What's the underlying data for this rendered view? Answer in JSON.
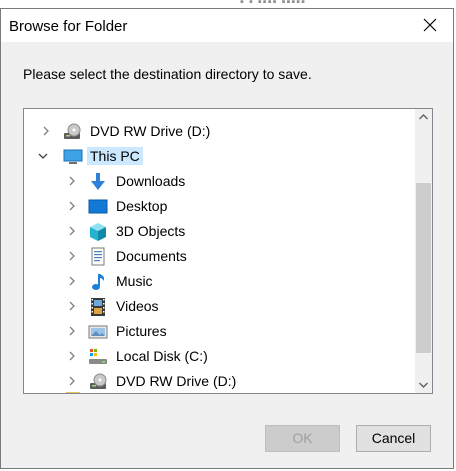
{
  "dialog": {
    "title": "Browse for Folder",
    "instruction": "Please select the destination directory to save."
  },
  "tree": {
    "items": [
      {
        "label": "DVD RW Drive (D:)",
        "icon": "dvd-drive-icon",
        "expanded": false,
        "selected": false
      },
      {
        "label": "This PC",
        "icon": "computer-icon",
        "expanded": true,
        "selected": true
      },
      {
        "label": "Downloads",
        "icon": "downloads-icon",
        "expanded": false,
        "selected": false
      },
      {
        "label": "Desktop",
        "icon": "desktop-icon",
        "expanded": false,
        "selected": false
      },
      {
        "label": "3D Objects",
        "icon": "3d-objects-icon",
        "expanded": false,
        "selected": false
      },
      {
        "label": "Documents",
        "icon": "documents-icon",
        "expanded": false,
        "selected": false
      },
      {
        "label": "Music",
        "icon": "music-icon",
        "expanded": false,
        "selected": false
      },
      {
        "label": "Videos",
        "icon": "videos-icon",
        "expanded": false,
        "selected": false
      },
      {
        "label": "Pictures",
        "icon": "pictures-icon",
        "expanded": false,
        "selected": false
      },
      {
        "label": "Local Disk (C:)",
        "icon": "local-disk-icon",
        "expanded": false,
        "selected": false
      },
      {
        "label": "DVD RW Drive (D:)",
        "icon": "dvd-drive-icon",
        "expanded": false,
        "selected": false
      }
    ]
  },
  "buttons": {
    "ok": "OK",
    "cancel": "Cancel"
  },
  "colors": {
    "selection": "#cce8ff",
    "accent": "#0078d7"
  }
}
